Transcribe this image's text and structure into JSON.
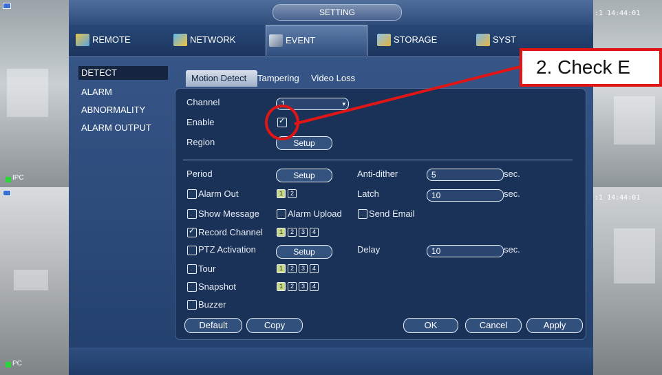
{
  "window": {
    "title": "SETTING"
  },
  "topnav": {
    "tabs": [
      {
        "label": "REMOTE",
        "icon": "remote-icon",
        "active": false
      },
      {
        "label": "NETWORK",
        "icon": "network-icon",
        "active": false
      },
      {
        "label": "EVENT",
        "icon": "event-icon",
        "active": true
      },
      {
        "label": "STORAGE",
        "icon": "storage-icon",
        "active": false
      },
      {
        "label": "SYST",
        "icon": "system-icon",
        "active": false
      }
    ]
  },
  "sidebar": {
    "items": [
      {
        "label": "DETECT",
        "active": true
      },
      {
        "label": "ALARM",
        "active": false
      },
      {
        "label": "ABNORMALITY",
        "active": false
      },
      {
        "label": "ALARM OUTPUT",
        "active": false
      }
    ]
  },
  "subtabs": [
    {
      "label": "Motion Detect",
      "active": true
    },
    {
      "label": "Tampering",
      "active": false
    },
    {
      "label": "Video Loss",
      "active": false
    }
  ],
  "form": {
    "channel_label": "Channel",
    "channel_value": "1",
    "enable_label": "Enable",
    "enable_checked": true,
    "region_label": "Region",
    "region_button": "Setup",
    "period_label": "Period",
    "period_button": "Setup",
    "anti_dither_label": "Anti-dither",
    "anti_dither_value": "5",
    "anti_dither_unit": "sec.",
    "alarm_out_label": "Alarm Out",
    "alarm_out_channels": [
      "1",
      "2"
    ],
    "latch_label": "Latch",
    "latch_value": "10",
    "latch_unit": "sec.",
    "show_message_label": "Show Message",
    "alarm_upload_label": "Alarm Upload",
    "send_email_label": "Send Email",
    "record_channel_label": "Record Channel",
    "record_channel_checked": true,
    "record_channels": [
      "1",
      "2",
      "3",
      "4"
    ],
    "ptz_activation_label": "PTZ Activation",
    "ptz_button": "Setup",
    "delay_label": "Delay",
    "delay_value": "10",
    "delay_unit": "sec.",
    "tour_label": "Tour",
    "tour_channels": [
      "1",
      "2",
      "3",
      "4"
    ],
    "snapshot_label": "Snapshot",
    "snapshot_channels": [
      "1",
      "2",
      "3",
      "4"
    ],
    "buzzer_label": "Buzzer"
  },
  "buttons": {
    "default": "Default",
    "copy": "Copy",
    "ok": "OK",
    "cancel": "Cancel",
    "apply": "Apply"
  },
  "cameras": {
    "top_left_label": "IPC",
    "bottom_left_label": "PC",
    "top_right_time": ":1 14:44:01",
    "bottom_right_time": ":1 14:44:01"
  },
  "annotation": {
    "callout_text": "2. Check E"
  },
  "colors": {
    "annotation_red": "#e01515",
    "accent_blue": "#223f6d"
  }
}
